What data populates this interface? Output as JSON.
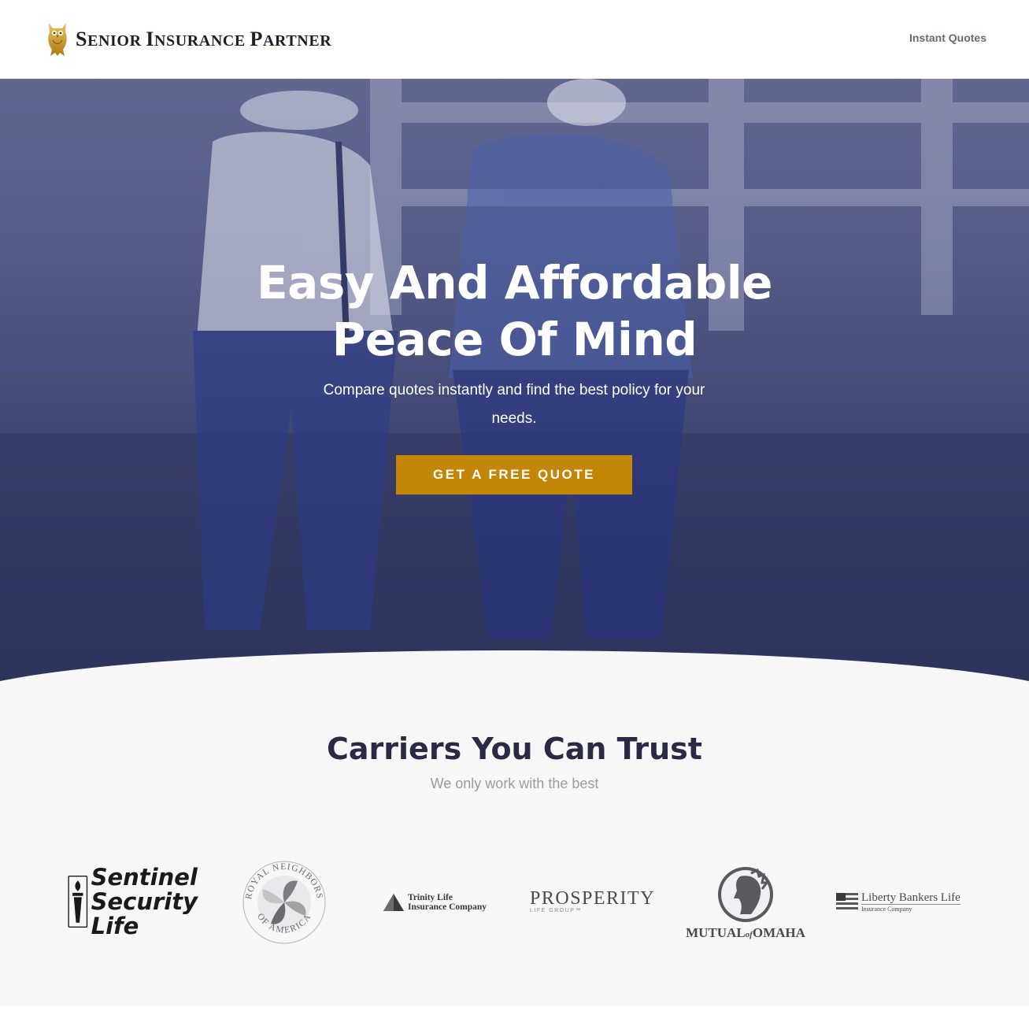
{
  "header": {
    "logo_text_parts": [
      "S",
      "ENIOR ",
      "I",
      "NSURANCE ",
      "P",
      "ARTNER"
    ],
    "logo_alt": "Senior Insurance Partner",
    "nav": [
      {
        "label": "Instant Quotes"
      }
    ]
  },
  "hero": {
    "title_line1": "Easy And Affordable",
    "title_line2": "Peace Of Mind",
    "subtitle": "Compare quotes instantly and find the best policy for your needs.",
    "cta_label": "GET A FREE QUOTE"
  },
  "carriers": {
    "title": "Carriers You Can Trust",
    "subtitle": "We only work with the best",
    "logos": [
      {
        "name": "Sentinel Security Life",
        "lines": [
          "Sentinel",
          "Security",
          "Life"
        ]
      },
      {
        "name": "Royal Neighbors of America",
        "top": "ROYAL NEIGHBORS",
        "bottom": "OF AMERICA"
      },
      {
        "name": "Trinity Life Insurance Company",
        "lines": [
          "Trinity Life",
          "Insurance Company"
        ]
      },
      {
        "name": "Prosperity Life Group",
        "main": "PROSPERITY",
        "sub": "LIFE GROUP™"
      },
      {
        "name": "Mutual of Omaha",
        "main": "MUTUAL",
        "of": "of",
        "end": "OMAHA"
      },
      {
        "name": "Liberty Bankers Life",
        "main": "Liberty Bankers Life",
        "sub": "Insurance Company"
      }
    ]
  },
  "colors": {
    "accent": "#c48606",
    "hero_overlay": "#212966",
    "heading_dark": "#2b2a45",
    "section_bg": "#f7f7f8"
  }
}
